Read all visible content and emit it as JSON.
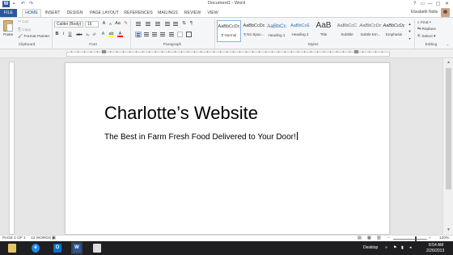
{
  "app": {
    "window_title": "Document1 - Word",
    "quick_access": {
      "save_icon": "save-icon",
      "undo_icon": "undo-icon",
      "redo_icon": "redo-icon"
    },
    "window_controls": [
      "?",
      "▭",
      "—",
      "▢",
      "✕"
    ]
  },
  "tabs": [
    "FILE",
    "HOME",
    "INSERT",
    "DESIGN",
    "PAGE LAYOUT",
    "REFERENCES",
    "MAILINGS",
    "REVIEW",
    "VIEW"
  ],
  "user": {
    "name": "Elizabeth Nolls"
  },
  "ribbon": {
    "clipboard": {
      "paste": "Paste",
      "cut": "Cut",
      "copy": "Copy",
      "format_painter": "Format Painter",
      "label": "Clipboard"
    },
    "font": {
      "font_name": "Calibri (Body)",
      "font_size": "16",
      "label": "Font",
      "buttons": [
        "B",
        "I",
        "U",
        "abc",
        "x₂",
        "x²",
        "A",
        "A"
      ]
    },
    "paragraph": {
      "label": "Paragraph"
    },
    "styles": {
      "label": "Styles",
      "items": [
        {
          "sample": "AaBbCcDc",
          "name": "¶ Normal"
        },
        {
          "sample": "AaBbCcDc",
          "name": "¶ No Spac..."
        },
        {
          "sample": "AaBbCc",
          "name": "Heading 1"
        },
        {
          "sample": "AaBbCcE",
          "name": "Heading 2"
        },
        {
          "sample": "AaB",
          "name": "Title"
        },
        {
          "sample": "AaBbCcC",
          "name": "Subtitle"
        },
        {
          "sample": "AaBbCcDc",
          "name": "Subtle Em..."
        },
        {
          "sample": "AaBbCcDc",
          "name": "Emphasis"
        }
      ]
    },
    "editing": {
      "find": "Find",
      "replace": "Replace",
      "select": "Select",
      "label": "Editing"
    }
  },
  "document": {
    "title": "Charlotte’s Website",
    "subtitle": "The Best in Farm Fresh Food Delivered to Your Door!"
  },
  "status": {
    "page": "PAGE 1 OF 1",
    "words": "12 WORDS",
    "zoom": "120%"
  },
  "taskbar": {
    "desktop": "Desktop",
    "time": "8:54 AM",
    "date": "2/26/2013"
  },
  "colors": {
    "accent": "#2b579a",
    "taskbar": "#1f1f22"
  }
}
